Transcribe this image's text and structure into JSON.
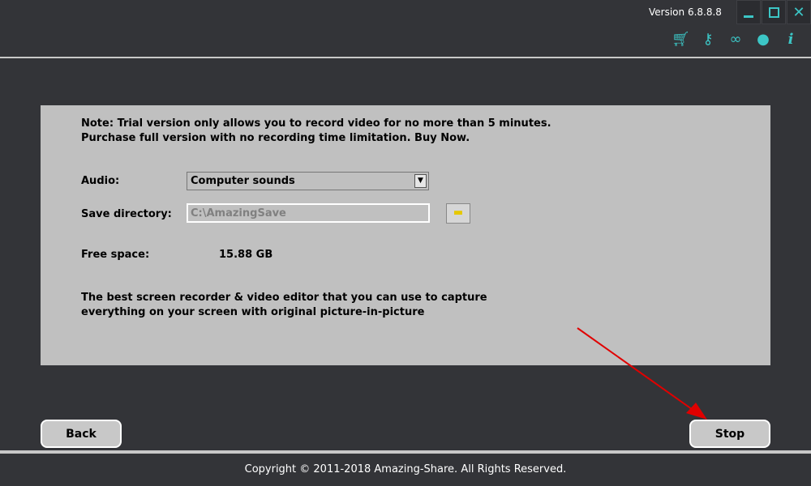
{
  "header": {
    "version": "Version 6.8.8.8",
    "window_buttons": [
      "minimize-icon",
      "maximize-icon",
      "close-icon"
    ],
    "tools": [
      "cart-icon",
      "key-icon",
      "chat-icon",
      "support-headset-icon",
      "info-icon"
    ],
    "accent": "#3cc6c6"
  },
  "note": {
    "line1": "Note: Trial version only allows you to record video for no more than 5 minutes.",
    "line2": "Purchase full version with no recording time limitation. Buy Now."
  },
  "audio": {
    "label": "Audio:",
    "value": "Computer sounds"
  },
  "save_directory": {
    "label": "Save directory:",
    "value": "C:\\AmazingSave"
  },
  "free_space": {
    "label": "Free space:",
    "value": "15.88 GB"
  },
  "description": {
    "line1": "The best screen recorder & video editor that you can use to capture",
    "line2": "everything on your screen with original picture-in-picture"
  },
  "buttons": {
    "back": "Back",
    "stop": "Stop"
  },
  "footer": {
    "copyright": "Copyright © 2011-2018 Amazing-Share. All Rights Reserved."
  }
}
